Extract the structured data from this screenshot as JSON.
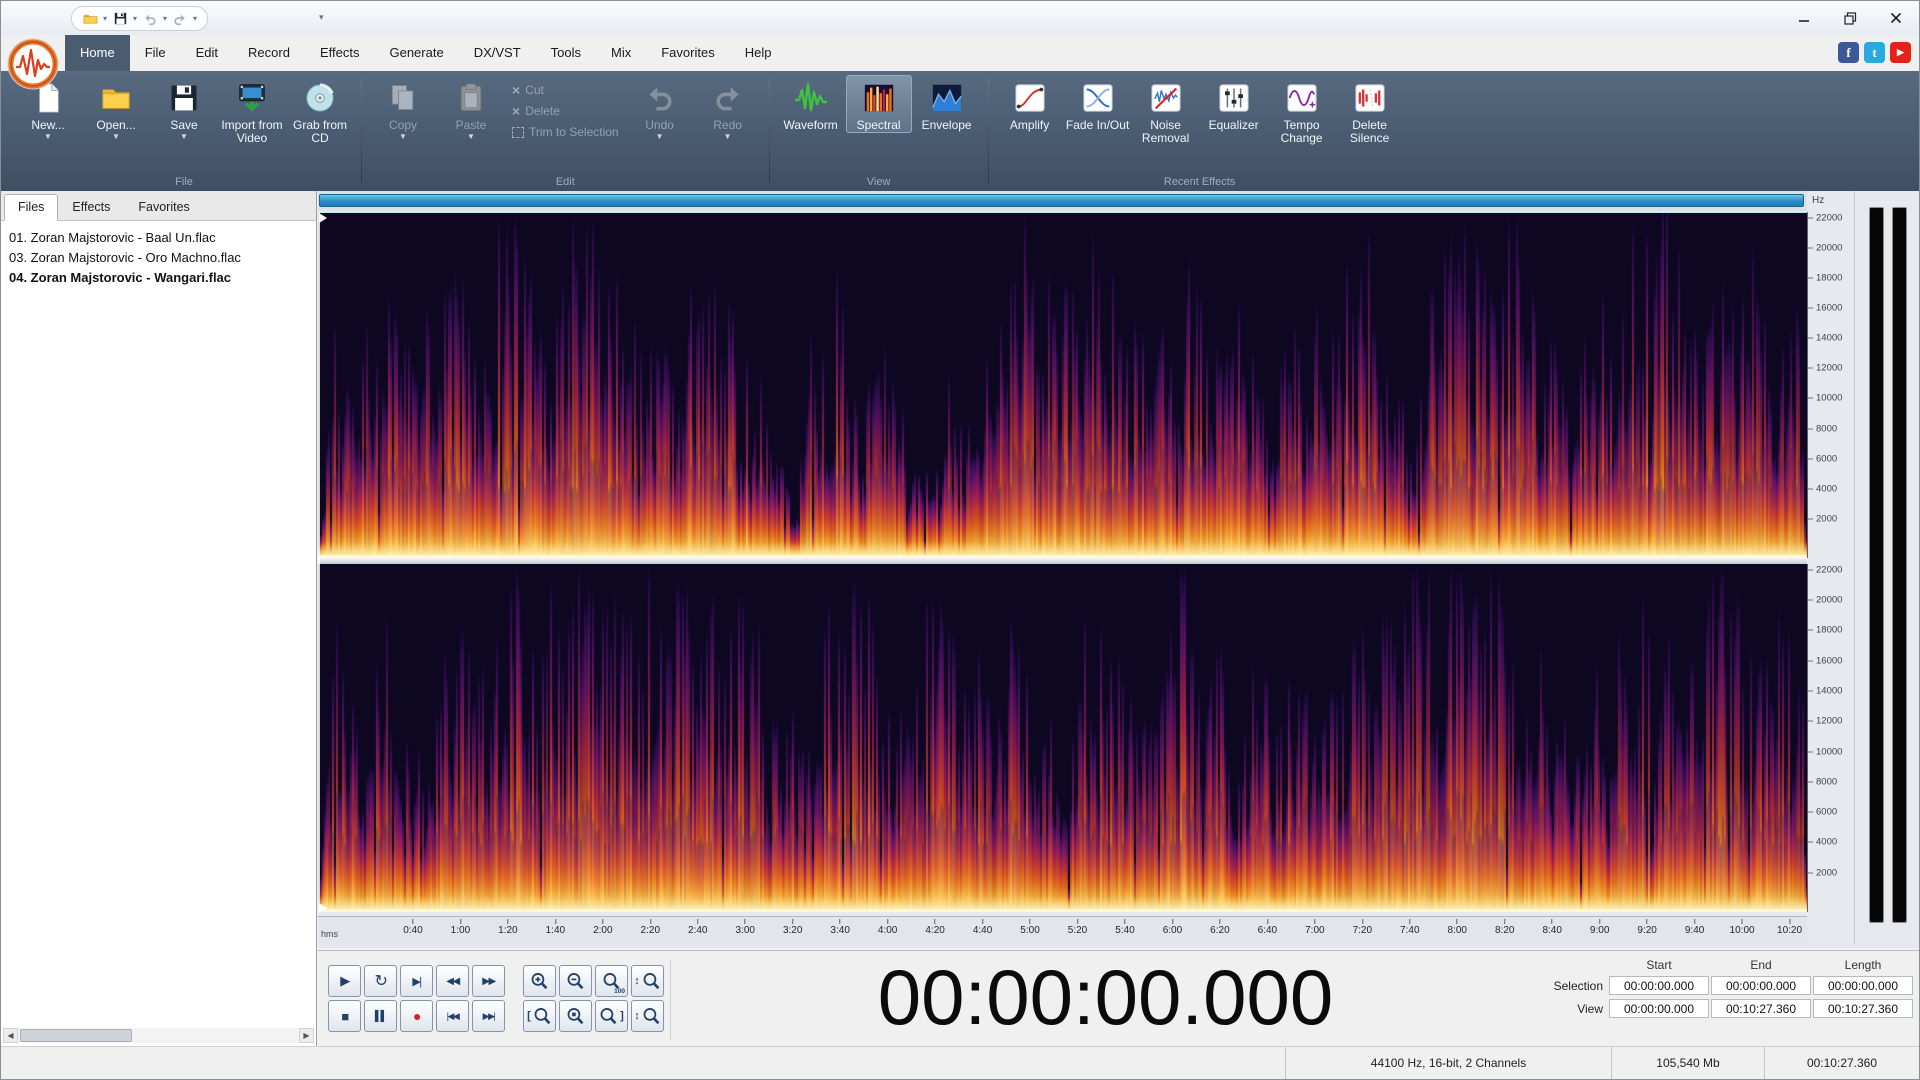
{
  "titlebar": {
    "quick_access": [
      "open-folder",
      "save",
      "undo",
      "redo"
    ],
    "window_controls": [
      "minimize",
      "restore",
      "close"
    ]
  },
  "menubar": {
    "tabs": [
      {
        "label": "Home",
        "active": true
      },
      {
        "label": "File"
      },
      {
        "label": "Edit"
      },
      {
        "label": "Record"
      },
      {
        "label": "Effects"
      },
      {
        "label": "Generate"
      },
      {
        "label": "DX/VST"
      },
      {
        "label": "Tools"
      },
      {
        "label": "Mix"
      },
      {
        "label": "Favorites"
      },
      {
        "label": "Help"
      }
    ]
  },
  "social": [
    {
      "name": "facebook",
      "glyph": "f",
      "color": "#3b5998"
    },
    {
      "name": "twitter",
      "glyph": "t",
      "color": "#29a9e1"
    },
    {
      "name": "youtube",
      "glyph": "▶",
      "color": "#e62117"
    }
  ],
  "ribbon": {
    "groups": [
      {
        "label": "File",
        "buttons": [
          {
            "label": "New..."
          },
          {
            "label": "Open..."
          },
          {
            "label": "Save"
          },
          {
            "label": "Import from Video"
          },
          {
            "label": "Grab from CD"
          }
        ]
      },
      {
        "label": "Edit",
        "buttons": [
          {
            "label": "Copy"
          },
          {
            "label": "Paste"
          },
          {
            "label": "Cut"
          },
          {
            "label": "Delete"
          },
          {
            "label": "Trim to Selection"
          },
          {
            "label": "Undo"
          },
          {
            "label": "Redo"
          }
        ]
      },
      {
        "label": "View",
        "buttons": [
          {
            "label": "Waveform"
          },
          {
            "label": "Spectral",
            "selected": true
          },
          {
            "label": "Envelope"
          }
        ]
      },
      {
        "label": "Recent Effects",
        "buttons": [
          {
            "label": "Amplify"
          },
          {
            "label": "Fade In/Out"
          },
          {
            "label": "Noise Removal"
          },
          {
            "label": "Equalizer"
          },
          {
            "label": "Tempo Change"
          },
          {
            "label": "Delete Silence"
          }
        ]
      }
    ]
  },
  "file_panel": {
    "tabs": [
      {
        "label": "Files",
        "active": true
      },
      {
        "label": "Effects"
      },
      {
        "label": "Favorites"
      }
    ],
    "files": [
      {
        "name": "01. Zoran Majstorovic - Baal Un.flac"
      },
      {
        "name": "03. Zoran Majstorovic - Oro Machno.flac"
      },
      {
        "name": "04. Zoran Majstorovic - Wangari.flac",
        "selected": true
      }
    ]
  },
  "spectral_view": {
    "hz_label": "Hz",
    "ruler_unit": "hms",
    "channels": 2,
    "freq_ticks": [
      22000,
      20000,
      18000,
      16000,
      14000,
      12000,
      10000,
      8000,
      6000,
      4000,
      2000
    ],
    "freq_max": 22050,
    "time_ticks": [
      "0:40",
      "1:00",
      "1:20",
      "1:40",
      "2:00",
      "2:20",
      "2:40",
      "3:00",
      "3:20",
      "3:40",
      "4:00",
      "4:20",
      "4:40",
      "5:00",
      "5:20",
      "5:40",
      "6:00",
      "6:20",
      "6:40",
      "7:00",
      "7:20",
      "7:40",
      "8:00",
      "8:20",
      "8:40",
      "9:00",
      "9:20",
      "9:40",
      "10:00",
      "10:20"
    ],
    "tick_start_seconds": 40,
    "tick_step_seconds": 20,
    "view_seconds": 627.36
  },
  "transport": {
    "rows": [
      [
        {
          "name": "play",
          "glyph": "▶",
          "size": 13
        },
        {
          "name": "loop-playback",
          "glyph": "↻",
          "size": 16
        },
        {
          "name": "play-to-end",
          "glyph": "▶|",
          "size": 11
        },
        {
          "name": "rewind",
          "glyph": "◀◀",
          "size": 10
        },
        {
          "name": "fast-forward",
          "glyph": "▶▶",
          "size": 10
        }
      ],
      [
        {
          "name": "stop",
          "glyph": "■",
          "size": 13
        },
        {
          "name": "pause",
          "glyph": "▌▌",
          "size": 10
        },
        {
          "name": "record",
          "glyph": "●",
          "size": 14,
          "color": "#d82018"
        },
        {
          "name": "go-to-start",
          "glyph": "|◀◀",
          "size": 9
        },
        {
          "name": "go-to-end",
          "glyph": "▶▶|",
          "size": 9
        }
      ]
    ],
    "zoom_rows": [
      [
        {
          "name": "zoom-in",
          "marker": "plus"
        },
        {
          "name": "zoom-out",
          "marker": "minus"
        },
        {
          "name": "zoom-normal",
          "sub": "100"
        },
        {
          "name": "zoom-vertical-in",
          "prefix": "↕"
        }
      ],
      [
        {
          "name": "zoom-selection-start",
          "prefix": "["
        },
        {
          "name": "zoom-to-selection",
          "marker": "dot"
        },
        {
          "name": "zoom-selection-end",
          "suffix": "]"
        },
        {
          "name": "zoom-vertical-out",
          "prefix": "↕"
        }
      ]
    ]
  },
  "time_display": {
    "value": "00:00:00.000"
  },
  "selection_info": {
    "col_headers": [
      "Start",
      "End",
      "Length"
    ],
    "rows": [
      {
        "label": "Selection",
        "values": [
          "00:00:00.000",
          "00:00:00.000",
          "00:00:00.000"
        ]
      },
      {
        "label": "View",
        "values": [
          "00:00:00.000",
          "00:10:27.360",
          "00:10:27.360"
        ]
      }
    ]
  },
  "statusbar": {
    "format": "44100 Hz, 16-bit, 2 Channels",
    "memory": "105,540 Mb",
    "length": "00:10:27.360"
  },
  "colors": {
    "ribbon_bg": "#47586c",
    "accent_blue": "#2b8cc8",
    "record_red": "#d82018",
    "spec_bg": "#0e0722",
    "spec_palette": [
      "#fffbc8",
      "#ffe289",
      "#fdae32",
      "#f0701f",
      "#d8432f",
      "#b02458",
      "#7b1a74",
      "#451077"
    ]
  }
}
